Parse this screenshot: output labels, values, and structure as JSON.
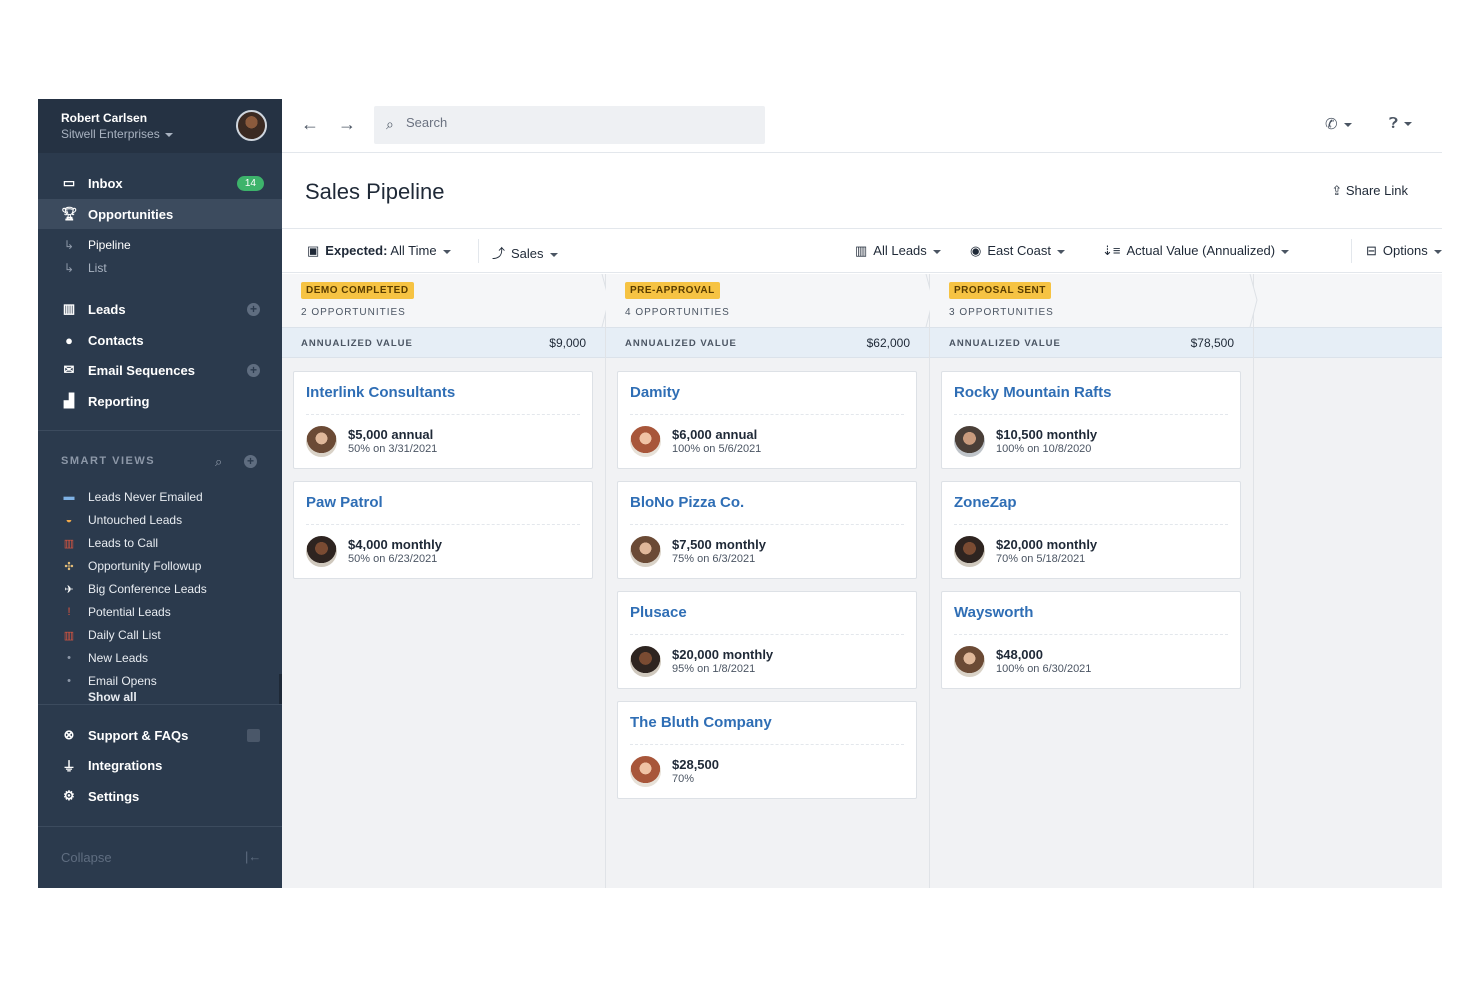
{
  "user": {
    "name": "Robert Carlsen",
    "org": "Sitwell Enterprises"
  },
  "nav": {
    "inbox": {
      "label": "Inbox",
      "badge": "14"
    },
    "opportunities": {
      "label": "Opportunities"
    },
    "pipeline": {
      "label": "Pipeline"
    },
    "list": {
      "label": "List"
    },
    "leads": {
      "label": "Leads"
    },
    "contacts": {
      "label": "Contacts"
    },
    "email_sequences": {
      "label": "Email Sequences"
    },
    "reporting": {
      "label": "Reporting"
    }
  },
  "smart_views": {
    "heading": "SMART VIEWS",
    "items": [
      {
        "label": "Leads Never Emailed",
        "icon": "mailbox-icon"
      },
      {
        "label": "Untouched Leads",
        "icon": "sleeping-icon"
      },
      {
        "label": "Leads to Call",
        "icon": "building-icon"
      },
      {
        "label": "Opportunity Followup",
        "icon": "handshake-icon"
      },
      {
        "label": "Big Conference Leads",
        "icon": "airplane-icon"
      },
      {
        "label": "Potential Leads",
        "icon": "exclamation-icon"
      },
      {
        "label": "Daily Call List",
        "icon": "building-icon"
      },
      {
        "label": "New Leads",
        "icon": "dot-icon"
      },
      {
        "label": "Email Opens",
        "icon": "dot-icon"
      }
    ],
    "show_all": "Show all"
  },
  "bottom_nav": {
    "support": "Support & FAQs",
    "integrations": "Integrations",
    "settings": "Settings",
    "collapse": "Collapse"
  },
  "topbar": {
    "search_placeholder": "Search"
  },
  "page": {
    "title": "Sales Pipeline",
    "share": "Share Link"
  },
  "filters": {
    "expected_label": "Expected:",
    "expected_value": "All Time",
    "pipeline": "Sales",
    "leads": "All Leads",
    "region": "East Coast",
    "sort": "Actual Value (Annualized)",
    "options": "Options"
  },
  "columns": [
    {
      "stage": "DEMO COMPLETED",
      "count": "2 OPPORTUNITIES",
      "value_label": "ANNUALIZED VALUE",
      "value": "$9,000",
      "cards": [
        {
          "name": "Interlink Consultants",
          "amount": "$5,000 annual",
          "meta": "50% on 3/31/2021",
          "avatar": "av-f1"
        },
        {
          "name": "Paw Patrol",
          "amount": "$4,000 monthly",
          "meta": "50% on 6/23/2021",
          "avatar": "av-m1"
        }
      ]
    },
    {
      "stage": "PRE-APPROVAL",
      "count": "4 OPPORTUNITIES",
      "value_label": "ANNUALIZED VALUE",
      "value": "$62,000",
      "cards": [
        {
          "name": "Damity",
          "amount": "$6,000 annual",
          "meta": "100% on 5/6/2021",
          "avatar": "av-f2"
        },
        {
          "name": "BloNo Pizza Co.",
          "amount": "$7,500 monthly",
          "meta": "75% on 6/3/2021",
          "avatar": "av-f1"
        },
        {
          "name": "Plusace",
          "amount": "$20,000 monthly",
          "meta": "95% on 1/8/2021",
          "avatar": "av-m1"
        },
        {
          "name": "The Bluth Company",
          "amount": "$28,500",
          "meta": "70%",
          "avatar": "av-f2"
        }
      ]
    },
    {
      "stage": "PROPOSAL SENT",
      "count": "3 OPPORTUNITIES",
      "value_label": "ANNUALIZED VALUE",
      "value": "$78,500",
      "cards": [
        {
          "name": "Rocky Mountain Rafts",
          "amount": "$10,500 monthly",
          "meta": "100% on 10/8/2020",
          "avatar": "av-m2"
        },
        {
          "name": "ZoneZap",
          "amount": "$20,000 monthly",
          "meta": "70% on 5/18/2021",
          "avatar": "av-m1"
        },
        {
          "name": "Waysworth",
          "amount": "$48,000",
          "meta": "100% on 6/30/2021",
          "avatar": "av-f1"
        }
      ]
    }
  ],
  "colors": {
    "sidebar": "#2b3a4d",
    "accent_link": "#2f6eb5",
    "stage_badge": "#f6c343",
    "inbox_badge": "#3db36b"
  }
}
